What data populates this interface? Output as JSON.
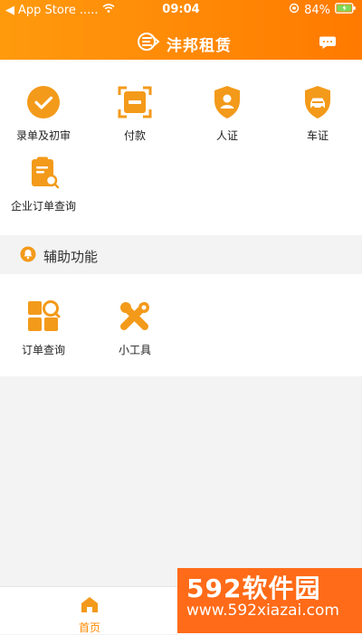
{
  "status_bar": {
    "carrier": "App Store",
    "signal": ".....",
    "time": "09:04",
    "battery": "84%"
  },
  "header": {
    "app_name": "沣邦租赁"
  },
  "main_menu": [
    {
      "label": "录单及初审",
      "icon": "check-circle-icon"
    },
    {
      "label": "付款",
      "icon": "payment-scan-icon"
    },
    {
      "label": "人证",
      "icon": "person-shield-icon"
    },
    {
      "label": "车证",
      "icon": "car-shield-icon"
    },
    {
      "label": "企业订单查询",
      "icon": "clipboard-search-icon"
    }
  ],
  "section": {
    "title": "辅助功能",
    "icon": "bell-icon"
  },
  "tools": [
    {
      "label": "订单查询",
      "icon": "grid-search-icon"
    },
    {
      "label": "小工具",
      "icon": "tools-icon"
    }
  ],
  "bottom_nav": {
    "home_label": "首页",
    "home_icon": "home-icon"
  },
  "watermark": {
    "main": "592软件园",
    "sub": "www.592xiazai.com"
  },
  "colors": {
    "accent": "#ff8a00",
    "header_start": "#ff9a0d",
    "header_end": "#ff7a00",
    "watermark": "#ff6b18"
  }
}
